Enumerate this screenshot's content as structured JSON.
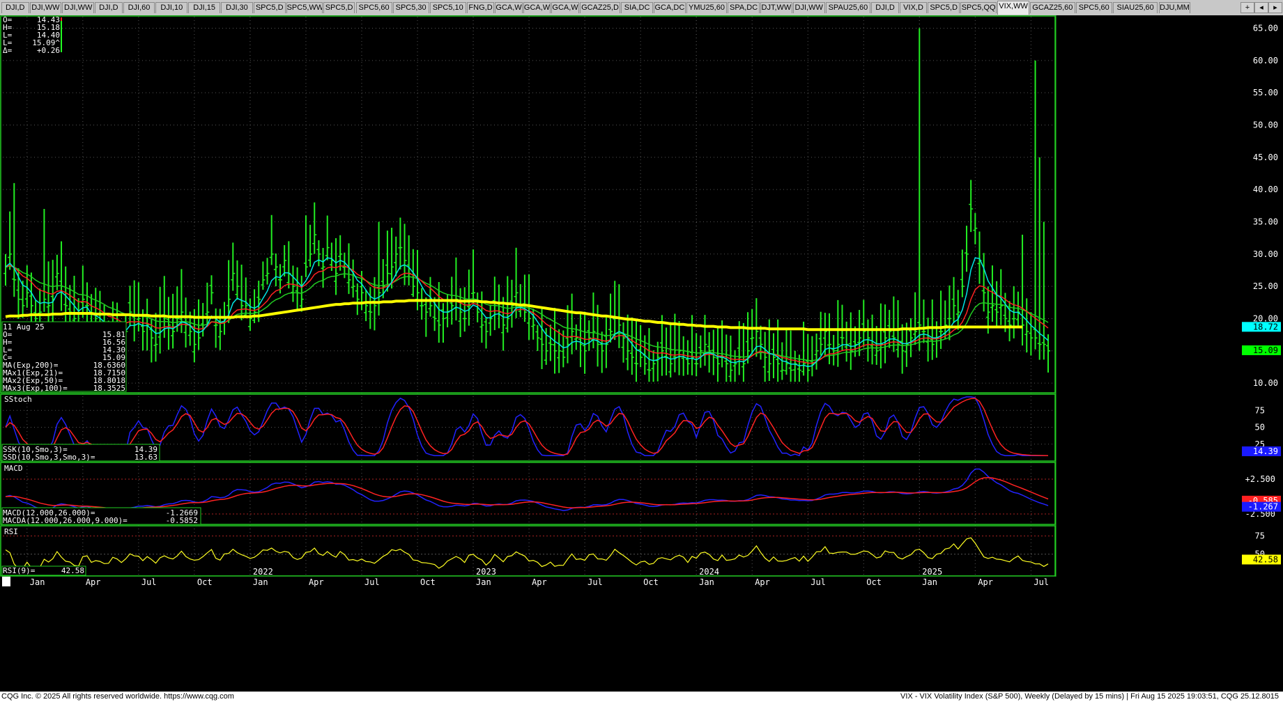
{
  "tabs": [
    "DJI,D",
    "DJI,WW",
    "DJI,WW",
    "DJI,D",
    "DJI,60",
    "DJI,10",
    "DJI,15",
    "DJI,30",
    "SPC5,D",
    "SPC5,WW",
    "SPC5,D",
    "SPC5,60",
    "SPC5,30",
    "SPC5,10",
    "FNG,D",
    "GCA,W",
    "GCA,W",
    "GCA,W",
    "GCAZ25,D",
    "SIA,DC",
    "GCA,DC",
    "YMU25,60",
    "SPA,DC",
    "DJT,WW",
    "DJI,WW",
    "SPAU25,60",
    "DJI,D",
    "VIX,D",
    "SPC5,D",
    "SPC5,QQ",
    "VIX,WW",
    "GCAZ25,60",
    "SPC5,60",
    "SIAU25,60",
    "DJU,MM"
  ],
  "active_tab": "VIX,WW",
  "tab_controls": {
    "add": "+",
    "prev": "◂",
    "next": "▸"
  },
  "quote": {
    "rows": [
      {
        "label": "O=",
        "value": "14.43"
      },
      {
        "label": "H=",
        "value": "15.18"
      },
      {
        "label": "L=",
        "value": "14.40"
      },
      {
        "label": "L=",
        "value": "15.09^"
      },
      {
        "label": "Δ=",
        "value": "+0.26"
      }
    ]
  },
  "bar_info": {
    "date": "11 Aug 25",
    "rows": [
      {
        "label": "O=",
        "value": "15.81"
      },
      {
        "label": "H=",
        "value": "16.56"
      },
      {
        "label": "L=",
        "value": "14.30"
      },
      {
        "label": "C=",
        "value": "15.09"
      },
      {
        "label": "MA(Exp,200)=",
        "value": "18.6360"
      },
      {
        "label": "MAx1(Exp,21)=",
        "value": "18.7150"
      },
      {
        "label": "MAx2(Exp,50)=",
        "value": "18.8018"
      },
      {
        "label": "MAx3(Exp,100)=",
        "value": "18.3525"
      }
    ]
  },
  "price_axis": {
    "ticks": [
      "65.00",
      "60.00",
      "55.00",
      "50.00",
      "45.00",
      "40.00",
      "35.00",
      "30.00",
      "25.00",
      "20.00",
      "15.00",
      "10.00"
    ],
    "tick_values": [
      65,
      60,
      55,
      50,
      45,
      40,
      35,
      30,
      25,
      20,
      15,
      10
    ],
    "marker_ma": "18.72",
    "marker_close": "15.09"
  },
  "sstoch": {
    "title": "SStoch",
    "ssk_label": "SSK(10,Smo,3)=",
    "ssk_value": "14.39",
    "ssd_label": "SSD(10,Smo,3,Smo,3)=",
    "ssd_value": "13.63",
    "ticks": [
      "75",
      "50",
      "25"
    ],
    "tick_values": [
      75,
      50,
      25
    ],
    "marker": "14.39"
  },
  "macd": {
    "title": "MACD",
    "macd_label": "MACD(12.000,26.000)=",
    "macd_value": "-1.2669",
    "macda_label": "MACDA(12.000,26.000,9.000)=",
    "macda_value": "-0.5852",
    "ticks": [
      "+2.500",
      "-2.500"
    ],
    "tick_values": [
      2.5,
      -2.5
    ],
    "marker_macda": "-0.585",
    "marker_macd": "-1.267"
  },
  "rsi": {
    "title": "RSI",
    "label": "RSI(9)=",
    "value": "42.58",
    "ticks": [
      "75",
      "50"
    ],
    "tick_values": [
      75,
      50
    ],
    "marker": "42.58"
  },
  "time_axis": {
    "labels": [
      {
        "t": "Jan",
        "i": 5
      },
      {
        "t": "Apr",
        "i": 18
      },
      {
        "t": "Jul",
        "i": 31
      },
      {
        "t": "Oct",
        "i": 44
      },
      {
        "t": "2022",
        "i": 57
      },
      {
        "t": "Jan",
        "i": 57
      },
      {
        "t": "Apr",
        "i": 70
      },
      {
        "t": "Jul",
        "i": 83
      },
      {
        "t": "Oct",
        "i": 96
      },
      {
        "t": "2023",
        "i": 109
      },
      {
        "t": "Jan",
        "i": 109
      },
      {
        "t": "Apr",
        "i": 122
      },
      {
        "t": "Jul",
        "i": 135
      },
      {
        "t": "Oct",
        "i": 148
      },
      {
        "t": "2024",
        "i": 161
      },
      {
        "t": "Jan",
        "i": 161
      },
      {
        "t": "Apr",
        "i": 174
      },
      {
        "t": "Jul",
        "i": 187
      },
      {
        "t": "Oct",
        "i": 200
      },
      {
        "t": "2025",
        "i": 213
      },
      {
        "t": "Jan",
        "i": 213
      },
      {
        "t": "Apr",
        "i": 226
      },
      {
        "t": "Jul",
        "i": 239
      }
    ]
  },
  "colors": {
    "bars": "#22ee22",
    "ma200": "#ffff00",
    "ma21": "#00e5e5",
    "ma50": "#ff2222",
    "ma100": "#22cc22",
    "ssk": "#2222ff",
    "ssd": "#ff2222",
    "macd": "#2222ff",
    "macda": "#ff2222",
    "rsi": "#ffff22",
    "marker_ma_bg": "#00ffff",
    "marker_close_bg": "#00ff00",
    "marker_blue_bg": "#1a1aff",
    "marker_red_bg": "#ff2020",
    "marker_yellow_bg": "#ffff00"
  },
  "chart_data": {
    "type": "bar",
    "series": [
      {
        "name": "VIX,WW",
        "values": [
          28,
          30,
          26,
          23,
          22,
          24,
          22,
          20,
          21,
          23,
          22,
          23,
          27,
          25,
          22,
          21,
          20,
          19,
          23,
          22,
          18,
          20,
          19,
          18,
          17,
          19,
          18,
          17,
          18,
          21,
          19,
          20,
          18,
          19,
          17,
          16,
          18,
          20,
          19,
          18,
          20,
          21,
          19,
          18,
          16,
          17,
          19,
          21,
          24,
          19,
          18,
          20,
          23,
          27,
          25,
          22,
          22,
          20,
          21,
          23,
          26,
          27,
          30,
          28,
          26,
          29,
          27,
          25,
          24,
          23,
          28,
          30,
          33,
          30,
          28,
          31,
          29,
          27,
          30,
          28,
          26,
          25,
          23,
          24,
          22,
          21,
          22,
          24,
          25,
          27,
          28,
          30,
          31,
          29,
          27,
          25,
          24,
          22,
          21,
          22,
          20,
          19,
          20,
          21,
          22,
          23,
          21,
          20,
          22,
          24,
          21,
          19,
          18,
          20,
          22,
          21,
          19,
          20,
          22,
          24,
          22,
          21,
          20,
          19,
          17,
          16,
          15,
          16,
          15,
          15,
          14,
          16,
          18,
          17,
          16,
          15,
          17,
          18,
          16,
          15,
          16,
          18,
          20,
          19,
          17,
          15,
          14,
          13,
          14,
          13,
          12,
          13,
          14,
          15,
          14,
          13,
          14,
          15,
          14,
          13,
          14,
          13,
          15,
          16,
          15,
          14,
          13,
          14,
          13,
          12,
          13,
          14,
          13,
          15,
          17,
          18,
          16,
          14,
          13,
          14,
          13,
          12,
          13,
          12,
          13,
          12,
          13,
          12,
          13,
          15,
          16,
          18,
          16,
          15,
          16,
          17,
          16,
          15,
          16,
          17,
          18,
          17,
          16,
          15,
          16,
          17,
          18,
          17,
          16,
          15,
          16,
          17,
          18,
          19,
          18,
          17,
          16,
          17,
          18,
          19,
          20,
          22,
          21,
          25,
          30,
          37,
          34,
          29,
          24,
          21,
          22,
          21,
          22,
          20,
          19,
          20,
          21,
          19,
          18,
          17,
          17,
          16,
          16,
          15
        ]
      },
      {
        "name": "MA(Exp,200)",
        "values": [
          20.3,
          20.4,
          20.4,
          20.4,
          20.5,
          20.5,
          20.6,
          20.6,
          20.6,
          20.6,
          20.6,
          20.7,
          20.7,
          20.7,
          20.8,
          20.8,
          20.8,
          20.8,
          20.8,
          20.8,
          20.8,
          20.7,
          20.7,
          20.7,
          20.7,
          20.6,
          20.6,
          20.6,
          20.6,
          20.6,
          20.5,
          20.5,
          20.5,
          20.5,
          20.4,
          20.4,
          20.4,
          20.4,
          20.3,
          20.3,
          20.3,
          20.3,
          20.3,
          20.3,
          20.2,
          20.2,
          20.2,
          20.2,
          20.2,
          20.2,
          20.2,
          20.2,
          20.2,
          20.2,
          20.3,
          20.3,
          20.3,
          20.3,
          20.4,
          20.4,
          20.5,
          20.6,
          20.7,
          20.8,
          20.9,
          21.0,
          21.1,
          21.2,
          21.3,
          21.4,
          21.5,
          21.6,
          21.7,
          21.8,
          21.9,
          22.0,
          22.1,
          22.2,
          22.2,
          22.3,
          22.3,
          22.4,
          22.4,
          22.4,
          22.5,
          22.5,
          22.5,
          22.5,
          22.6,
          22.6,
          22.6,
          22.7,
          22.7,
          22.7,
          22.8,
          22.8,
          22.8,
          22.8,
          22.8,
          22.8,
          22.8,
          22.8,
          22.8,
          22.8,
          22.8,
          22.8,
          22.7,
          22.7,
          22.7,
          22.7,
          22.7,
          22.6,
          22.6,
          22.5,
          22.5,
          22.4,
          22.4,
          22.3,
          22.3,
          22.2,
          22.1,
          22.1,
          22.0,
          21.9,
          21.8,
          21.7,
          21.6,
          21.5,
          21.4,
          21.3,
          21.2,
          21.1,
          21.0,
          20.9,
          20.9,
          20.8,
          20.7,
          20.6,
          20.5,
          20.4,
          20.4,
          20.3,
          20.2,
          20.1,
          20.0,
          19.9,
          19.9,
          19.8,
          19.7,
          19.6,
          19.6,
          19.5,
          19.4,
          19.4,
          19.3,
          19.2,
          19.2,
          19.1,
          19.1,
          19.0,
          19.0,
          18.9,
          18.9,
          18.8,
          18.8,
          18.8,
          18.7,
          18.7,
          18.7,
          18.6,
          18.6,
          18.6,
          18.6,
          18.5,
          18.5,
          18.5,
          18.5,
          18.5,
          18.4,
          18.4,
          18.4,
          18.4,
          18.4,
          18.4,
          18.4,
          18.4,
          18.4,
          18.3,
          18.3,
          18.3,
          18.3,
          18.3,
          18.3,
          18.3,
          18.3,
          18.3,
          18.3,
          18.3,
          18.3,
          18.3,
          18.3,
          18.3,
          18.3,
          18.3,
          18.3,
          18.3,
          18.3,
          18.3,
          18.3,
          18.4,
          18.4,
          18.4,
          18.4,
          18.5,
          18.5,
          18.6,
          18.6,
          18.6,
          18.6,
          18.7,
          18.7,
          18.7,
          18.7,
          18.7,
          18.7,
          18.7,
          18.7,
          18.7,
          18.7,
          18.7,
          18.7,
          18.7,
          18.7,
          18.7,
          18.7,
          18.7,
          18.7,
          18.7
        ]
      }
    ],
    "ylim": [
      10,
      66
    ]
  }
}
